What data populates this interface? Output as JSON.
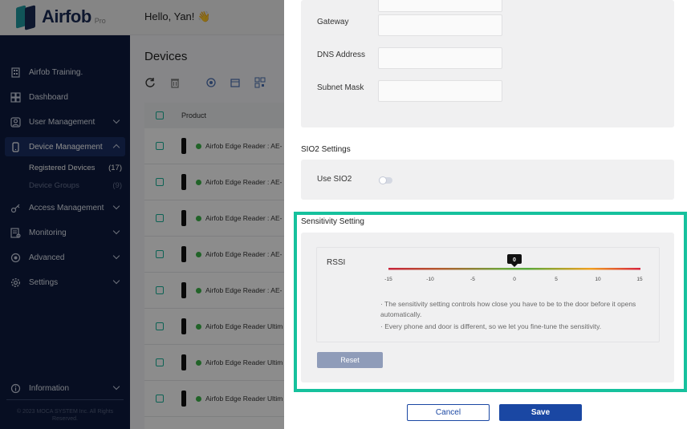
{
  "app": {
    "name": "Airfob",
    "edition": "Pro",
    "greeting": "Hello, Yan! 👋"
  },
  "sidebar": {
    "items": [
      {
        "label": "Airfob Training.",
        "icon": "building-icon"
      },
      {
        "label": "Dashboard",
        "icon": "dashboard-icon"
      },
      {
        "label": "User Management",
        "icon": "user-icon"
      },
      {
        "label": "Device Management",
        "icon": "device-icon",
        "active": true
      },
      {
        "label": "Access Management",
        "icon": "key-icon"
      },
      {
        "label": "Monitoring",
        "icon": "monitor-icon"
      },
      {
        "label": "Advanced",
        "icon": "advanced-icon"
      },
      {
        "label": "Settings",
        "icon": "gear-icon"
      }
    ],
    "subitems": [
      {
        "label": "Registered Devices",
        "count": "(17)"
      },
      {
        "label": "Device Groups",
        "count": "(9)"
      }
    ],
    "information": "Information",
    "copyright": "© 2023 MOCA SYSTEM Inc. All Rights Reserved."
  },
  "main": {
    "title": "Devices",
    "column_product": "Product",
    "rows": [
      "Airfob Edge Reader : AE-",
      "Airfob Edge Reader : AE-",
      "Airfob Edge Reader : AE-",
      "Airfob Edge Reader : AE-",
      "Airfob Edge Reader : AE-",
      "Airfob Edge Reader Ultim",
      "Airfob Edge Reader Ultim",
      "Airfob Edge Reader Ultim"
    ]
  },
  "drawer": {
    "gateway_label": "Gateway",
    "dns_label": "DNS Address",
    "subnet_label": "Subnet Mask",
    "sio2_title": "SIO2 Settings",
    "sio2_label": "Use SIO2",
    "sio2_enabled": false,
    "sensitivity_title": "Sensitivity Setting",
    "rssi_label": "RSSI",
    "rssi_value": "0",
    "rssi_ticks": [
      "-15",
      "-10",
      "-5",
      "0",
      "5",
      "10",
      "15"
    ],
    "notes": [
      "· The sensitivity setting controls how close you have to be to the door before it opens automatically.",
      "· Every phone and door is different, so we let you fine-tune the sensitivity."
    ],
    "reset_label": "Reset",
    "cancel_label": "Cancel",
    "save_label": "Save"
  },
  "colors": {
    "sidebar_bg": "#0d1b3e",
    "accent_blue": "#1a47a3",
    "highlight_green": "#16c19d",
    "status_online": "#3cb54a"
  }
}
